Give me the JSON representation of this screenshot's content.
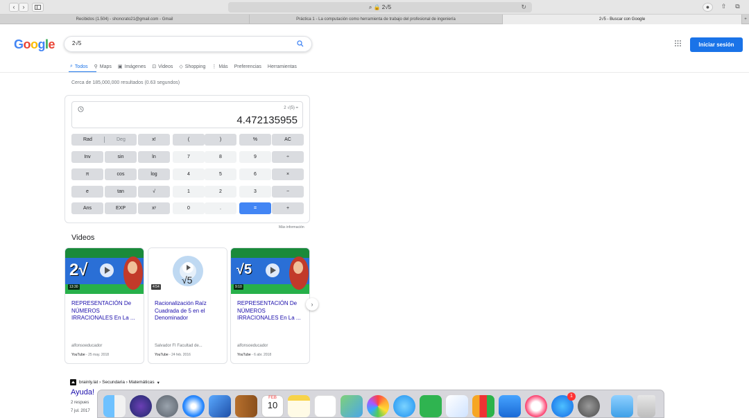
{
  "browser": {
    "url": "2√5",
    "tabs": [
      "Recibidos (1.504) - shoncrato21@gmail.com - Gmail",
      "Práctica 1 - La computación como herramienta de trabajo del profesional de ingeniería",
      "2√5 - Buscar con Google"
    ],
    "add_tab": "+"
  },
  "google": {
    "logo": [
      "G",
      "o",
      "o",
      "g",
      "l",
      "e"
    ],
    "query": "2√5",
    "signin": "Iniciar sesión",
    "nav": [
      "Todos",
      "Maps",
      "Imágenes",
      "Videos",
      "Shopping",
      "Más",
      "Preferencias",
      "Herramientas"
    ],
    "stats": "Cerca de 185,000,000 resultados (0.63 segundos)"
  },
  "calculator": {
    "expression": "2 √(5) =",
    "result": "4.472135955",
    "rad": "Rad",
    "deg": "Deg",
    "more_info": "Más información",
    "rows": [
      [
        "x!",
        "(",
        ")",
        "%",
        "AC"
      ],
      [
        "Inv",
        "sin",
        "ln",
        "7",
        "8",
        "9",
        "÷"
      ],
      [
        "π",
        "cos",
        "log",
        "4",
        "5",
        "6",
        "×"
      ],
      [
        "e",
        "tan",
        "√",
        "1",
        "2",
        "3",
        "−"
      ],
      [
        "Ans",
        "EXP",
        "xʸ",
        "0",
        ".",
        "=",
        "+"
      ]
    ]
  },
  "videos": {
    "heading": "Videos",
    "items": [
      {
        "title": "REPRESENTACIÓN De NÚMEROS IRRACIONALES En La ...",
        "channel": "alfonsoeducador",
        "source": "YouTube",
        "date": " - 25 may. 2018",
        "duration": "13:30",
        "thumb_text": "2√"
      },
      {
        "title": "Racionalización Raíz Cuadrada de 5 en el Denominador",
        "channel": "Salvador FI Facultad de...",
        "source": "YouTube",
        "date": " - 24 feb. 2016",
        "duration": "4:54",
        "thumb_text": "√5"
      },
      {
        "title": "REPRESENTACIÓN De NÚMEROS IRRACIONALES En La ...",
        "channel": "alfonsoeducador",
        "source": "YouTube",
        "date": " - 6 abr. 2018",
        "duration": "9:10",
        "thumb_text": "√5"
      }
    ],
    "next": "›"
  },
  "result": {
    "breadcrumb": "brainly.lat › Secundaria › Matemáticas",
    "title": "Ayuda!",
    "snippet1": "2 respues",
    "snippet2": "7 jul. 2017"
  },
  "dock": {
    "calendar_month": "FEB",
    "calendar_day": "10",
    "badge": "1"
  }
}
